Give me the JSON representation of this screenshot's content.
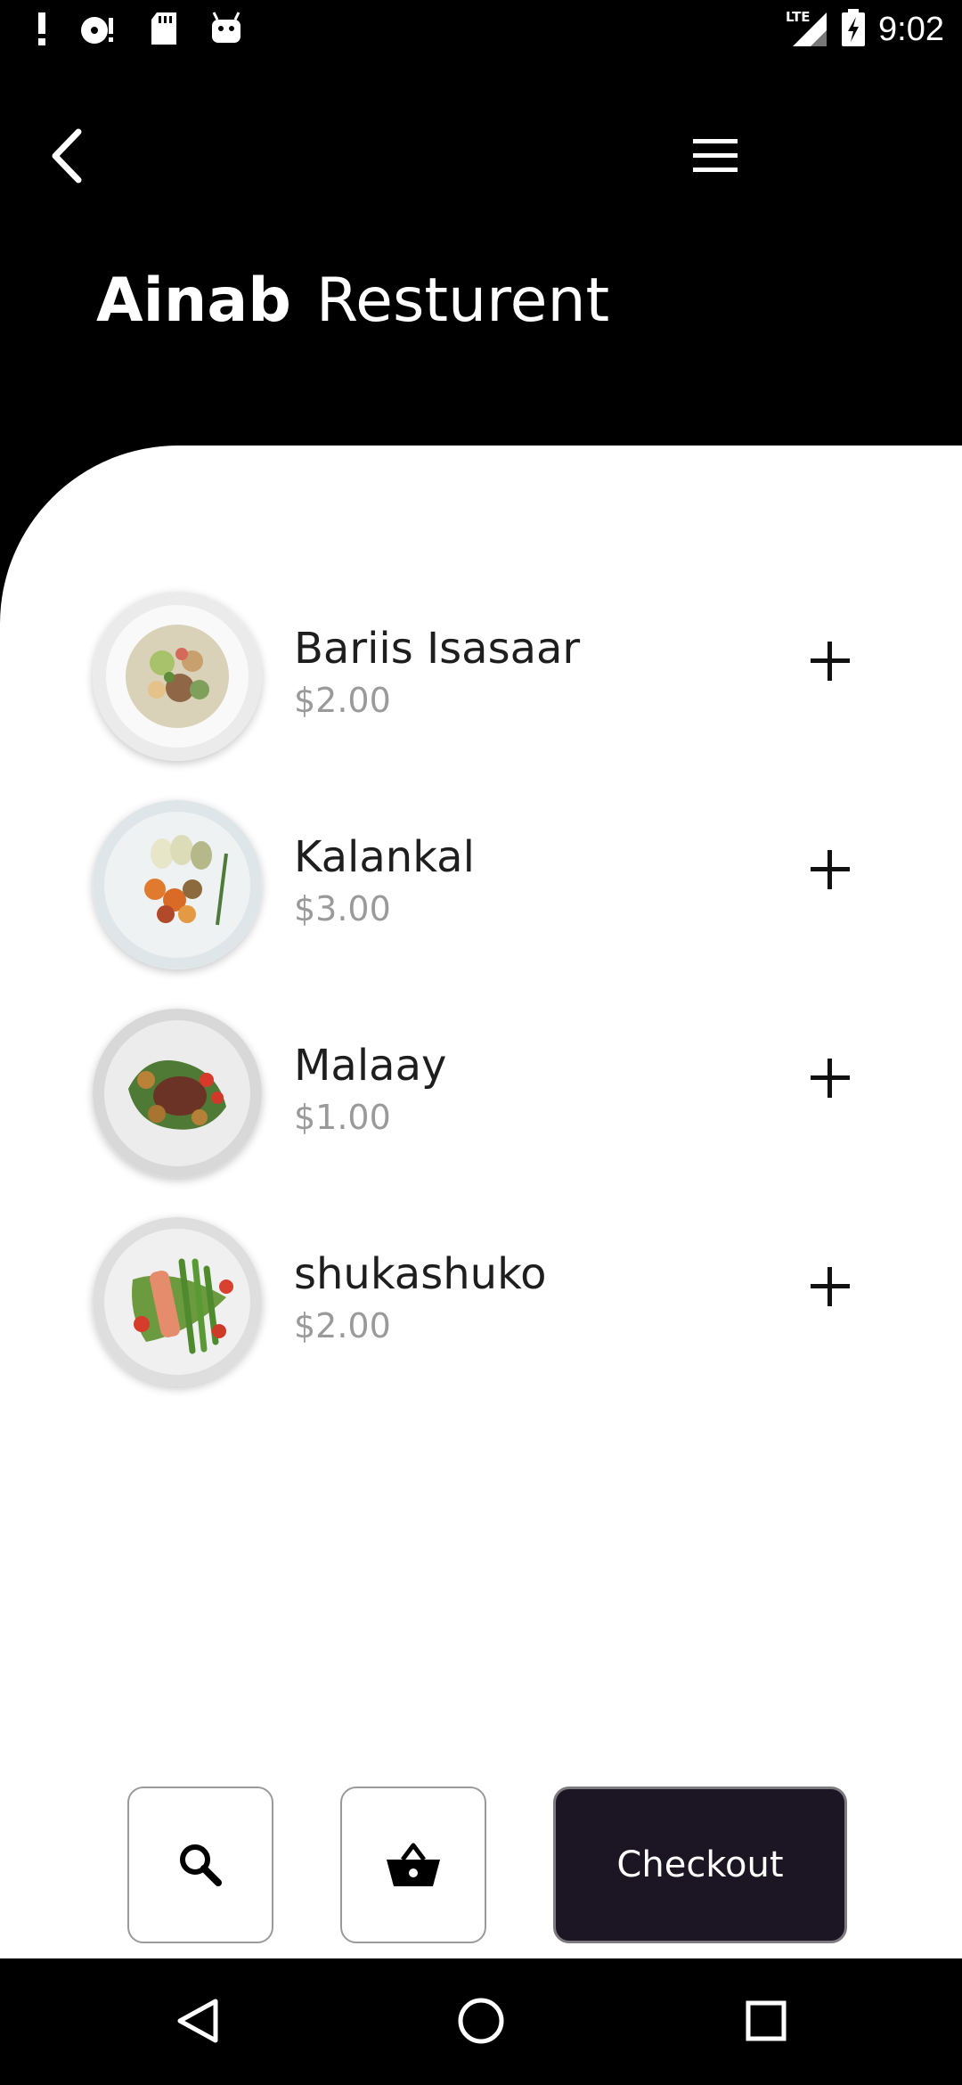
{
  "status_bar": {
    "time": "9:02",
    "network": "LTE",
    "left_icons": [
      "alert-icon",
      "media-disc-icon",
      "sd-card-icon",
      "android-icon"
    ],
    "right_icons": [
      "lte-signal-icon",
      "battery-charging-icon"
    ]
  },
  "header": {
    "title_bold": "Ainab",
    "title_regular": "Resturent",
    "back_icon": "chevron-left-icon",
    "menu_icon": "hamburger-menu-icon"
  },
  "menu": {
    "items": [
      {
        "name": "Bariis Isasaar",
        "price": "$2.00",
        "image": "rice-salad-plate"
      },
      {
        "name": "Kalankal",
        "price": "$3.00",
        "image": "roasted-vegetables-plate"
      },
      {
        "name": "Malaay",
        "price": "$1.00",
        "image": "steak-potatoes-plate"
      },
      {
        "name": "shukashuko",
        "price": "$2.00",
        "image": "salmon-asparagus-plate"
      }
    ],
    "add_icon": "plus-icon"
  },
  "actions": {
    "search_icon": "search-icon",
    "basket_icon": "basket-icon",
    "checkout_label": "Checkout"
  },
  "nav_bar": {
    "icons": [
      "back-triangle-icon",
      "home-circle-icon",
      "recents-square-icon"
    ]
  },
  "colors": {
    "background": "#000000",
    "sheet": "#ffffff",
    "checkout_bg": "#1b1524",
    "price_text": "#9a9a9a",
    "name_text": "#1e1e1e"
  }
}
